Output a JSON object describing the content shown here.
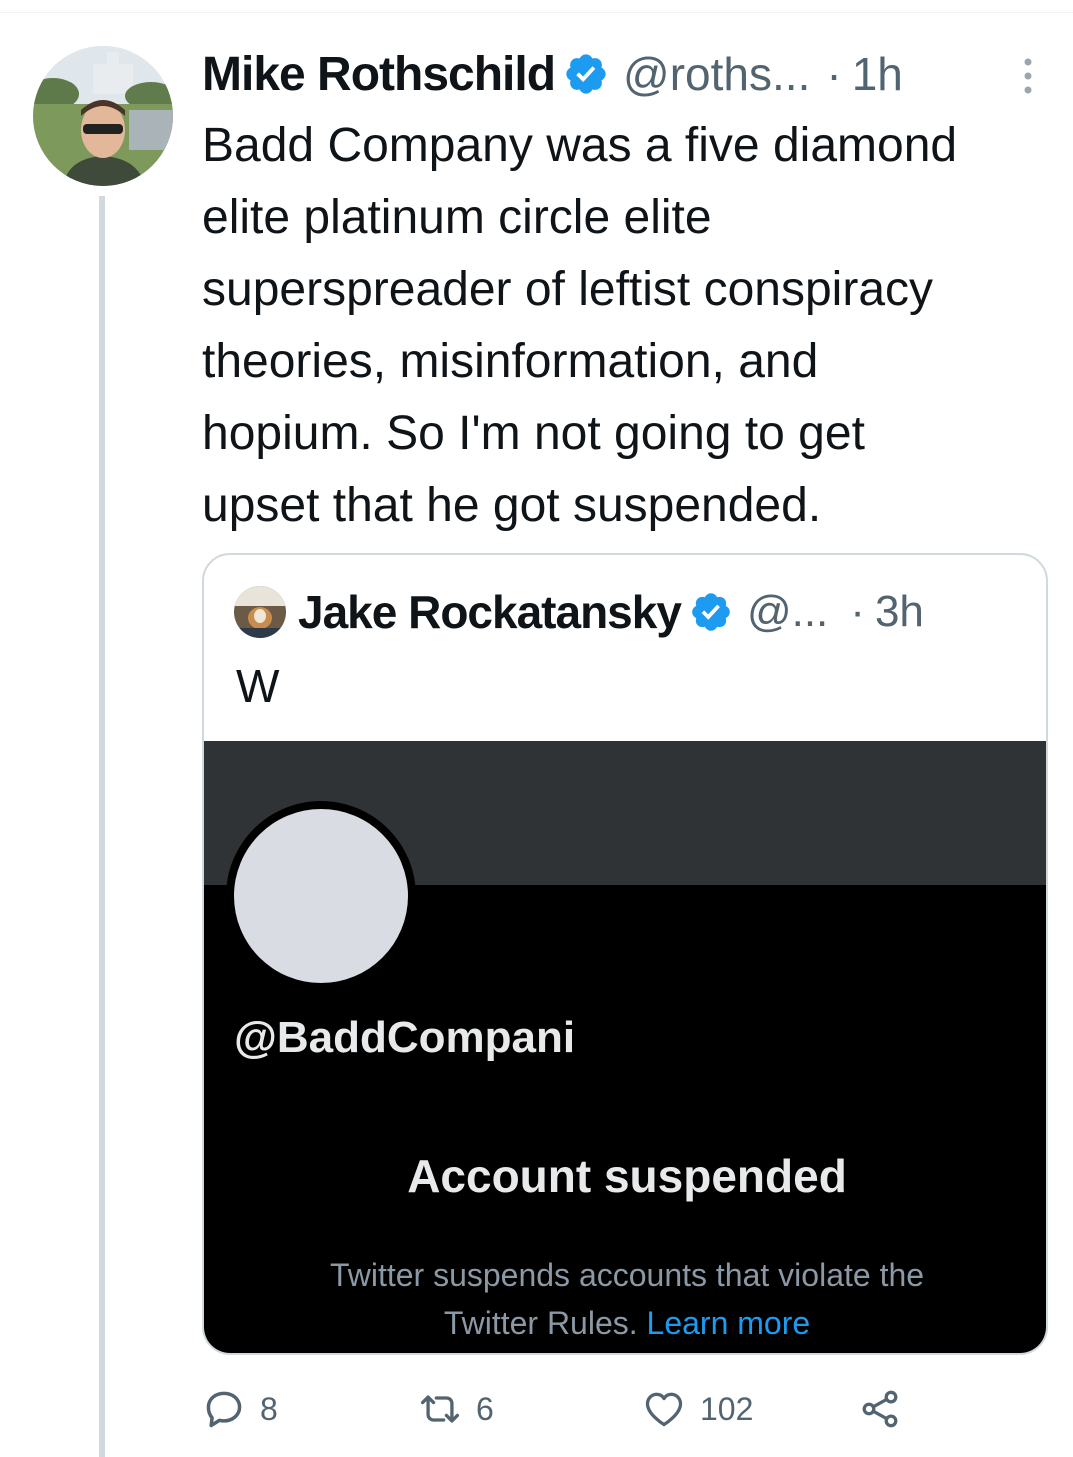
{
  "tweet": {
    "author_name": "Mike Rothschild",
    "handle": "@roths...",
    "separator": "·",
    "time": "1h",
    "text": "Badd Company was a five diamond\nelite platinum circle elite\nsuperspreader of leftist conspiracy\ntheories, misinformation, and\nhopium. So I'm not going to get\nupset that he got suspended."
  },
  "quote": {
    "author_name": "Jake Rockatansky",
    "handle": "@...",
    "separator": "·",
    "time": "3h",
    "text": "W",
    "media": {
      "handle": "@BaddCompani",
      "title": "Account suspended",
      "description": "Twitter suspends accounts that violate the\nTwitter Rules.",
      "link_text": "Learn more"
    }
  },
  "actions": {
    "replies": "8",
    "retweets": "6",
    "likes": "102"
  },
  "colors": {
    "verified": "#1d9bf0",
    "muted_text": "#536471",
    "link": "#1d9bf0"
  },
  "icons": {
    "reply": "reply-icon",
    "retweet": "retweet-icon",
    "like": "heart-icon",
    "share": "share-icon",
    "more": "more-vertical-icon",
    "verified": "verified-badge-icon"
  }
}
